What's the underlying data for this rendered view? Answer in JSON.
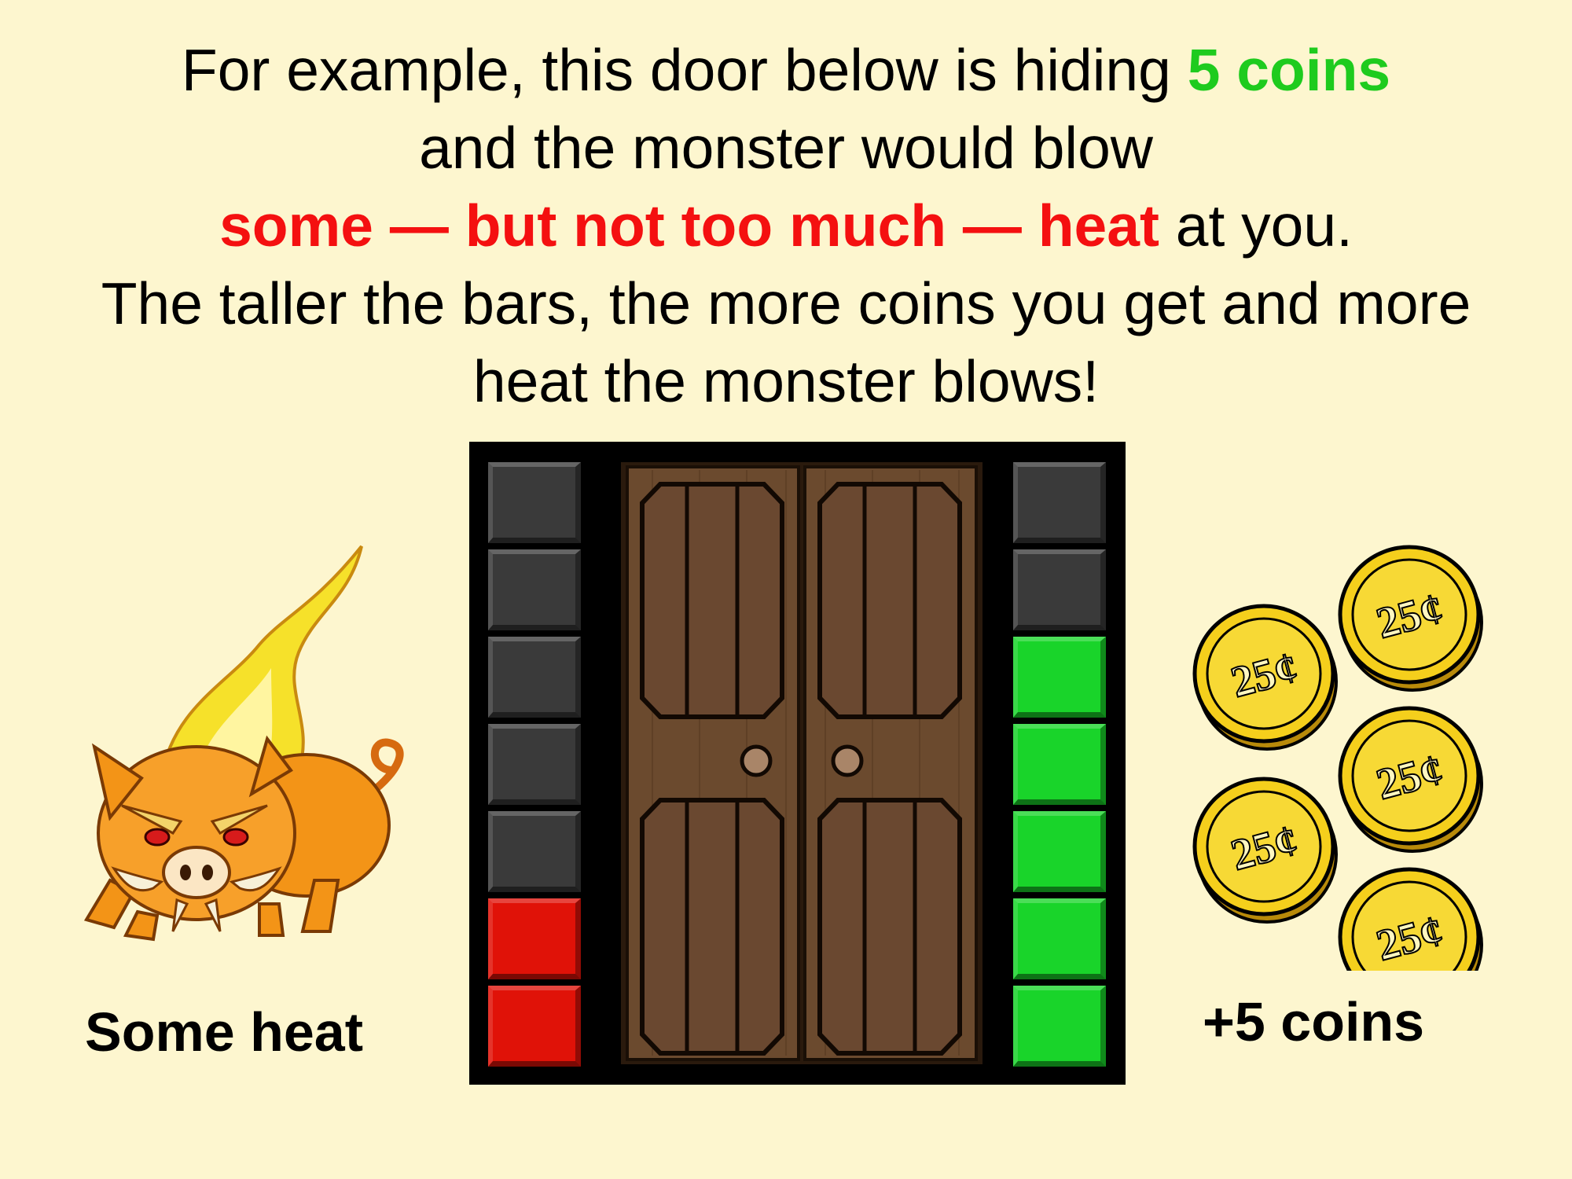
{
  "instructions": {
    "line1_pre": "For example, this door below is hiding ",
    "line1_highlight": "5 coins",
    "line2": "and the monster would blow",
    "line3_highlight": "some — but not too much — heat",
    "line3_post": " at you.",
    "line4": "The taller the bars, the more coins you get and more",
    "line5": "heat the monster blows!"
  },
  "heat_bar": {
    "segments": 7,
    "filled": 2,
    "color": "#e01208"
  },
  "coin_bar": {
    "segments": 7,
    "filled": 5,
    "color": "#19d42a"
  },
  "coins": {
    "count": 5,
    "coin_label": "25¢"
  },
  "captions": {
    "heat": "Some heat",
    "coins": "+5 coins"
  },
  "colors": {
    "background": "#fdf6cf",
    "highlight_green": "#1ecb1e",
    "highlight_red": "#f41010",
    "unlit_segment": "#3a3a3a",
    "door_wood": "#6b4a2e"
  }
}
